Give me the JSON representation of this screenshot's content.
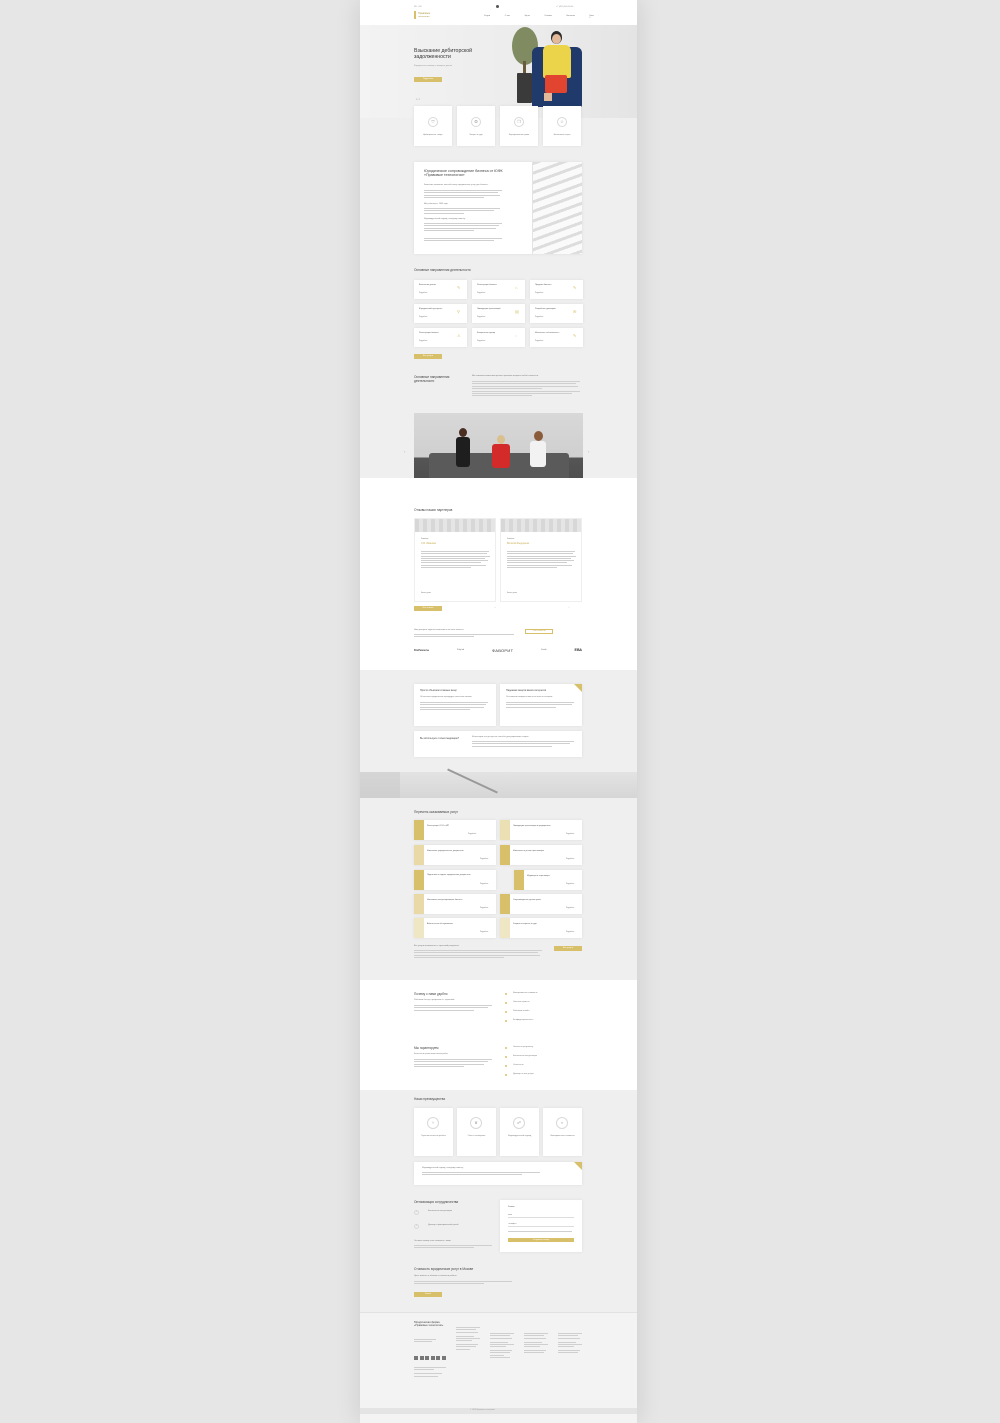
{
  "header": {
    "logo_title": "Правовые",
    "logo_sub": "технологии",
    "nav": [
      "Услуги",
      "О нас",
      "Цены",
      "Отзывы",
      "Контакты",
      "Блог"
    ],
    "phone": "+7 (495) 000-00-00"
  },
  "hero": {
    "title": "Взыскание дебиторской задолженности",
    "subtitle": "Юридическая помощь в возврате долгов",
    "button": "Подробнее",
    "slide": "1 / 2"
  },
  "features": [
    {
      "label": "Арбитражные споры",
      "icon": "shield-icon"
    },
    {
      "label": "Защита в суде",
      "icon": "award-icon"
    },
    {
      "label": "Корпоративное право",
      "icon": "docs-icon"
    },
    {
      "label": "Налоговые споры",
      "icon": "person-icon"
    }
  ],
  "intro": {
    "title": "Юридическое сопровождение бизнеса от ЮФК «Правовые технологии»",
    "paragraphs": [
      "Компания оказывает полный спектр юридических услуг для бизнеса.",
      "Мы работаем с 2005 года.",
      "Индивидуальный подход к каждому клиенту."
    ]
  },
  "directions": {
    "title": "Основные направления деятельности",
    "items": [
      "Взыскание долгов",
      "Регистрация бизнеса",
      "Продажа бизнеса",
      "Юридический аутсорсинг",
      "Ликвидация организаций",
      "Разработка договоров",
      "Регистрация бизнеса",
      "Банкротство юрлиц",
      "Интеллект. собственность"
    ],
    "more": "Все услуги",
    "more_link": "Подробнее"
  },
  "about": {
    "title": "Основные направления деятельности",
    "text": "Мы помогаем компаниям решать правовые вопросы любой сложности."
  },
  "reviews": {
    "title": "Отзывы наших партнеров",
    "items": [
      {
        "company": "Компания",
        "name": "С.В. Иванова",
        "more": "Читать далее"
      },
      {
        "company": "Компания",
        "name": "Виталий Федоренко",
        "more": "Читать далее"
      }
    ],
    "all": "Все отзывы"
  },
  "clients": {
    "text": "Нам доверяют крупные компании и частные клиенты.",
    "button": "Стать клиентом",
    "logos": [
      "ВсеРемонты",
      "PolyLab",
      "ФАВОРИТ",
      "Zenith",
      "ЕВА"
    ]
  },
  "qa": [
    {
      "q": "Просто объясним сложные вещи",
      "a": "Объясняем юридические процедуры понятным языком."
    },
    {
      "q": "Надежная защита ваших интересов",
      "a": "Отстаиваем позицию клиента во всех инстанциях."
    },
    {
      "q": "Вы используете только медиацию?",
      "a": "Используем все доступные способы урегулирования споров."
    }
  ],
  "services": {
    "title": "Перечень оказываемых услуг",
    "items": [
      "Регистрация ООО и ИП",
      "Ликвидация организации и предприятия",
      "Изменение учредительных документов",
      "Изменения в уставе организации",
      "Подготовка и подача юридических документов",
      "Медиация и переговоры",
      "Налоговое консультирование бизнеса",
      "Сопровождение сделок купли",
      "Абонентское обслуживание",
      "Защита интересов в суде"
    ],
    "price_link": "Подробнее",
    "note": "Все услуги оказываются с гарантией результата.",
    "button": "Все услуги"
  },
  "why": {
    "title": "Почему с нами удобно",
    "text": "Работаем быстро, прозрачно и с гарантией.",
    "list": [
      "Фиксированная стоимость",
      "Опытные юристы",
      "Работаем онлайн",
      "Конфиденциальность"
    ],
    "title2": "Мы гарантируем",
    "text2": "Качество и сроки выполнения работ.",
    "list2": [
      "Оплата по результату",
      "Бесплатная консультация",
      "Отчетность",
      "Договор на все услуги"
    ]
  },
  "advantages": {
    "title": "Наши преимущества",
    "items": [
      "Гарантия качества работы",
      "Опыт и экспертиза",
      "Индивидуальный подход",
      "Фиксированная стоимость"
    ],
    "note": "Индивидуальный подход к каждому клиенту."
  },
  "cooperation": {
    "title": "Оптимизация сотрудничества",
    "points": [
      "Бесплатная консультация",
      "Договор с фиксированной ценой"
    ],
    "text": "Оставьте заявку и мы свяжемся с вами.",
    "form_title": "Заявка",
    "name_ph": "Имя",
    "phone_ph": "Телефон",
    "submit": "Отправить заявку"
  },
  "pricing": {
    "title": "Стоимость юридических услуг в Москве",
    "text": "Цены зависят от объема и сложности работы.",
    "button": "Узнать"
  },
  "footer": {
    "brand": "Юридическая фирма «Правовые технологии»",
    "copyright": "© 2024 Правовые технологии"
  },
  "colors": {
    "accent": "#d8c06a",
    "page_bg": "#efefef"
  }
}
